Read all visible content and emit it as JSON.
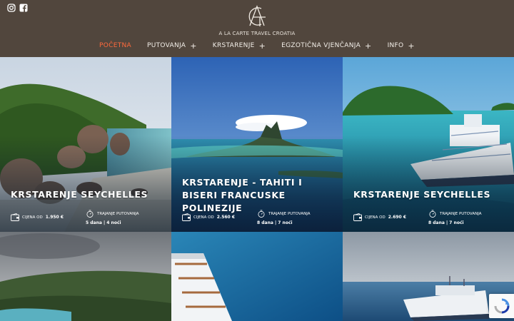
{
  "header": {
    "brand": "A LA CARTE TRAVEL CROATIA",
    "logo_icon": "act-monogram-icon",
    "social": [
      "instagram-icon",
      "facebook-icon"
    ],
    "accent_color": "#ff6a3d",
    "background_color": "#51463d"
  },
  "nav": {
    "items": [
      {
        "label": "POČETNA",
        "active": true
      },
      {
        "label": "PUTOVANJA",
        "plus": "+"
      },
      {
        "label": "KRSTARENJE",
        "plus": "+"
      },
      {
        "label": "EGZOTIČNA VJENČANJA",
        "plus": "+"
      },
      {
        "label": "INFO",
        "plus": "+"
      }
    ]
  },
  "tiles": [
    {
      "title": "KRSTARENJE SEYCHELLES",
      "price_label": "CIJENA OD",
      "price": "1.950 €",
      "duration_label": "TRAJANJE PUTOVANJA",
      "duration": "5 dana | 4 noći"
    },
    {
      "title": "KRSTARENJE - TAHITI I BISERI FRANCUSKE POLINEZIJE",
      "price_label": "CIJENA OD",
      "price": "2.560 €",
      "duration_label": "TRAJANJE PUTOVANJA",
      "duration": "8 dana | 7 noći"
    },
    {
      "title": "KRSTARENJE SEYCHELLES",
      "price_label": "CIJENA OD",
      "price": "2.690 €",
      "duration_label": "TRAJANJE PUTOVANJA",
      "duration": "8 dana | 7 noći"
    }
  ],
  "widgets": {
    "recaptcha_icon": "recaptcha-icon"
  }
}
